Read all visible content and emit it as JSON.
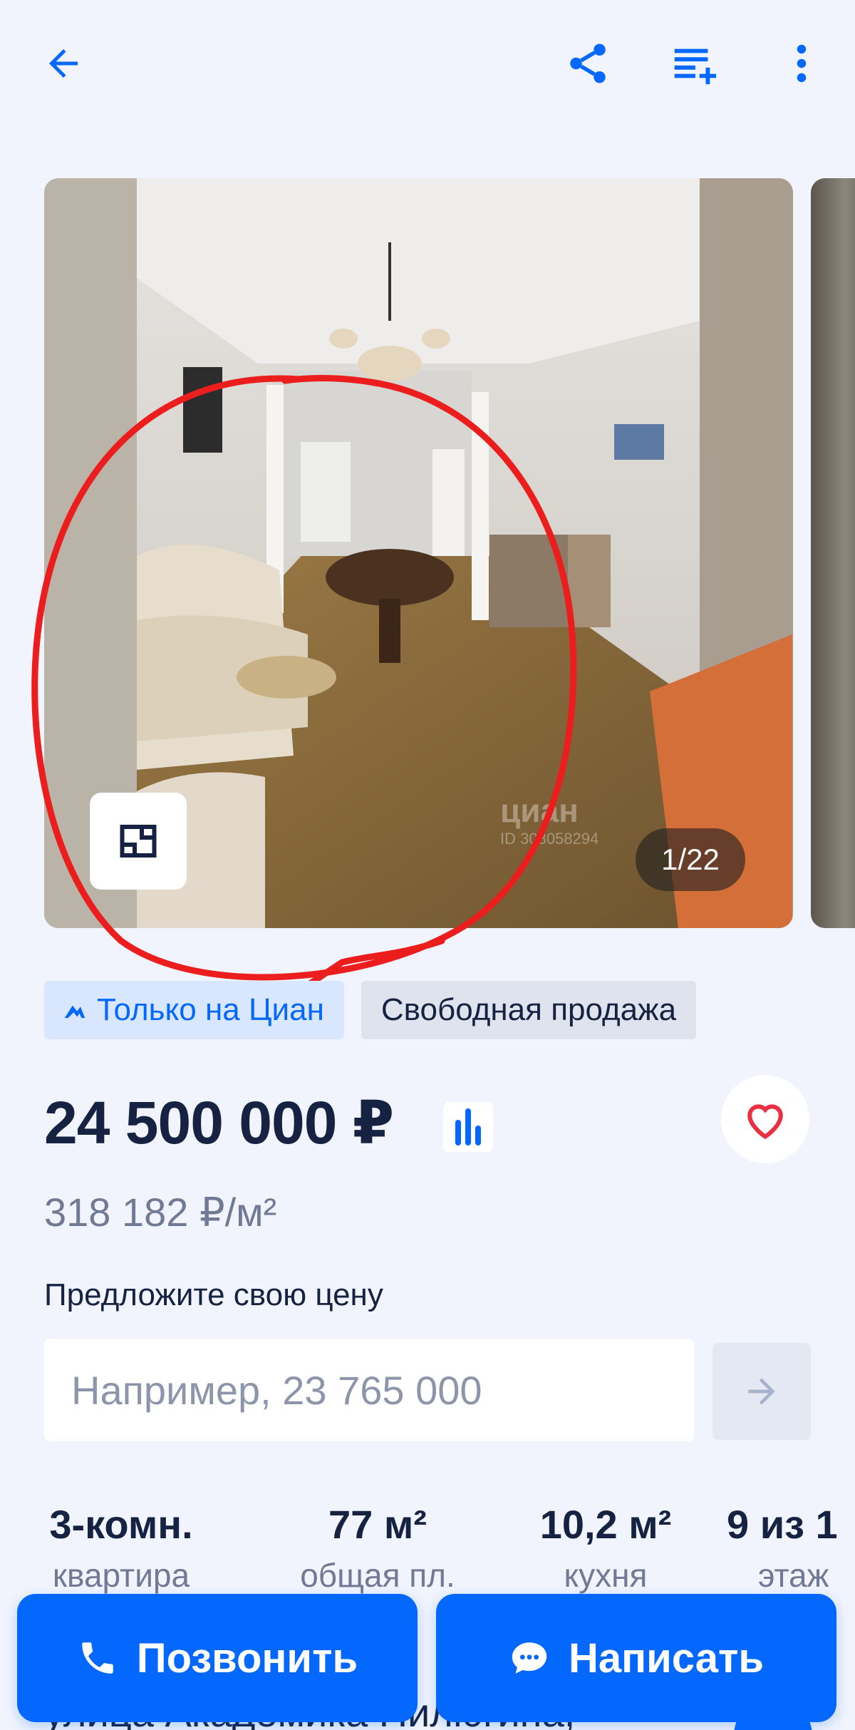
{
  "toolbar": {
    "back_icon": "arrow-left-icon",
    "share_icon": "share-icon",
    "add_to_list_icon": "playlist-add-icon",
    "more_icon": "more-vertical-icon",
    "accent_color": "#0468ff"
  },
  "gallery": {
    "counter": "1/22",
    "watermark": "циан",
    "watermark_id": "ID 308058294",
    "plan_icon": "floor-plan-icon"
  },
  "badges": {
    "cian_only": "Только на Циан",
    "free_sale": "Свободная продажа"
  },
  "price": {
    "value": "24 500 000 ₽",
    "per_meter": "318 182 ₽/м²",
    "favorite_color": "#ea2f43"
  },
  "offer": {
    "label": "Предложите свою цену",
    "placeholder": "Например, 23 765 000"
  },
  "params": [
    {
      "value": "3-комн.",
      "label": "квартира"
    },
    {
      "value": "77 м²",
      "label": "общая пл."
    },
    {
      "value": "10,2 м²",
      "label": "кухня"
    },
    {
      "value": "9 из 1",
      "label": "этаж"
    }
  ],
  "address": "улица Академика Пилюгина,",
  "actions": {
    "call_label": "Позвонить",
    "write_label": "Написать"
  }
}
